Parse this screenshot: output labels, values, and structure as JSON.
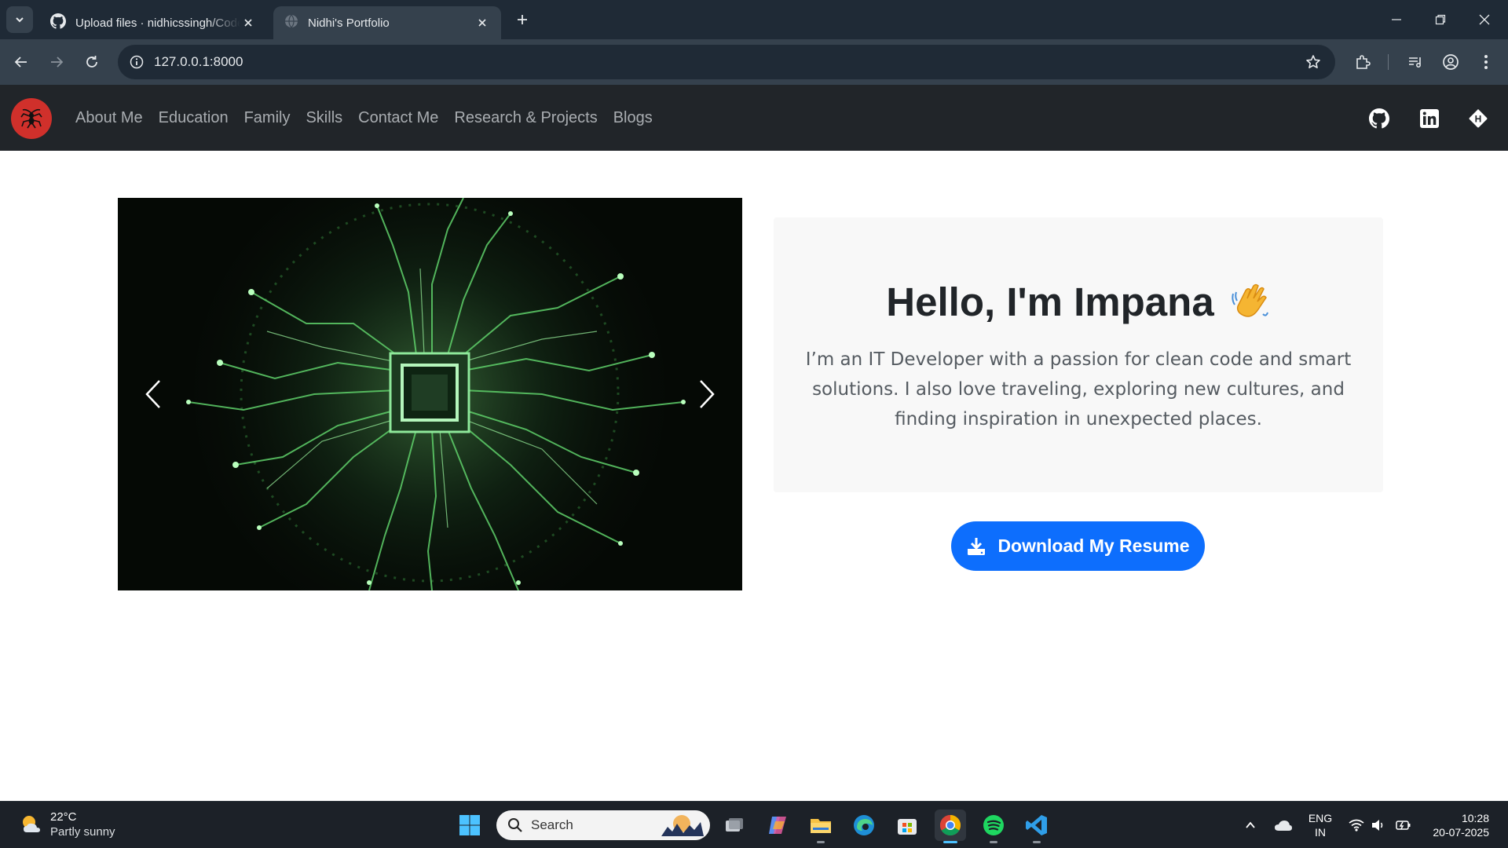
{
  "browser": {
    "tabs": [
      {
        "title": "Upload files · nidhicssingh/Code",
        "active": false
      },
      {
        "title": "Nidhi's Portfolio",
        "active": true
      }
    ],
    "url": "127.0.0.1:8000"
  },
  "navbar": {
    "links": [
      "About Me",
      "Education",
      "Family",
      "Skills",
      "Contact Me",
      "Research & Projects",
      "Blogs"
    ],
    "social_icons": [
      "github-icon",
      "linkedin-icon",
      "hashnode-icon"
    ]
  },
  "hero": {
    "title": "Hello, I'm Impana",
    "description": "I’m an IT Developer with a passion for clean code and smart solutions. I also love traveling, exploring new cultures, and finding inspiration in unexpected places.",
    "resume_button": "Download My Resume"
  },
  "taskbar": {
    "weather_temp": "22°C",
    "weather_condition": "Partly sunny",
    "search_label": "Search",
    "lang_line1": "ENG",
    "lang_line2": "IN",
    "time": "10:28",
    "date": "20-07-2025"
  },
  "colors": {
    "navbar_bg": "#212529",
    "accent": "#0d6efd",
    "brand_logo": "#d0302b",
    "hero_card_bg": "#f8f8f8"
  }
}
